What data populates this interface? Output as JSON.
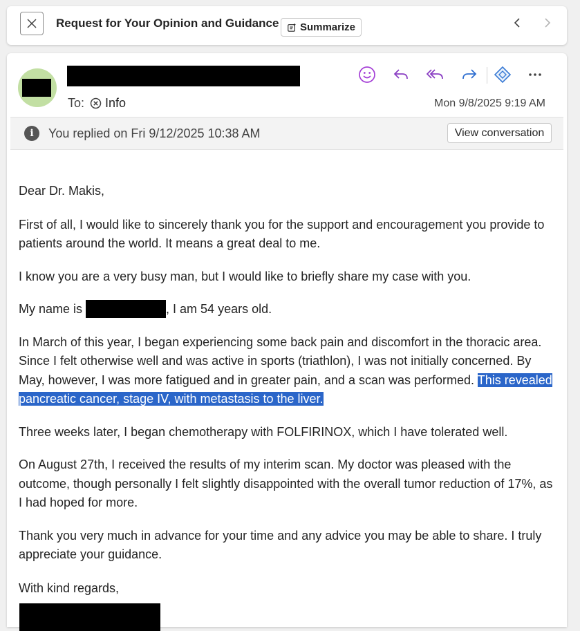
{
  "header": {
    "subject": "Request for Your Opinion and Guidance",
    "summarize_label": "Summarize"
  },
  "message": {
    "to_label": "To:",
    "recipient": "Info",
    "date": "Mon 9/8/2025 9:19 AM",
    "info_bar_text": "You replied on Fri 9/12/2025 10:38 AM",
    "view_conversation_label": "View conversation",
    "accent_color": "#a43fd6",
    "action_icon_color": "#8a3ec3"
  },
  "body": {
    "greeting": "Dear Dr. Makis,",
    "p1": "First of all, I would like to sincerely thank you for the support and encouragement you provide to patients around the world. It means a great deal to me.",
    "p2": "I know you are a very busy man, but I would like to briefly share my case with you.",
    "p3_before": "My name is ",
    "p3_after": ", I am 54 years old.",
    "p4_main": "In March of this year, I began experiencing some back pain and discomfort in the thoracic area. Since I felt otherwise well and was active in sports (triathlon), I was not initially concerned. By May, however, I was more fatigued and in greater pain, and a scan was performed. ",
    "p4_highlight": "This revealed pancreatic cancer, stage IV, with metastasis to the liver.",
    "p5": "Three weeks later, I began chemotherapy with FOLFIRINOX, which I have tolerated well.",
    "p6": "On August 27th, I received the results of my interim scan. My doctor was pleased with the outcome, though personally I felt slightly disappointed with the overall tumor reduction of 17%, as I had hoped for more.",
    "p7": "Thank you very much in advance for your time and any advice you may be able to share. I truly appreciate your guidance.",
    "closing": "With kind regards,"
  }
}
